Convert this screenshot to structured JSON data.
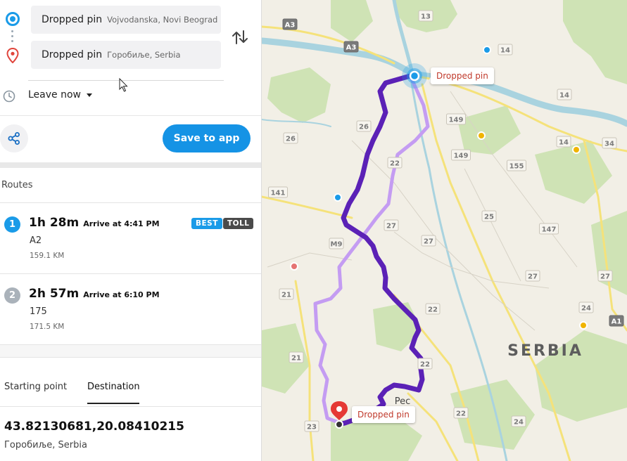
{
  "directions": {
    "origin": {
      "title": "Dropped pin",
      "subtitle": "Vojvodanska, Novi Beograd"
    },
    "destination": {
      "title": "Dropped pin",
      "subtitle": "Горобиље, Serbia"
    },
    "leave_label": "Leave now"
  },
  "actions": {
    "save_label": "Save to app"
  },
  "routes": {
    "heading": "Routes",
    "items": [
      {
        "number": "1",
        "duration": "1h 28m",
        "arrive": "Arrive at 4:41 PM",
        "road": "A2",
        "distance": "159.1 KM",
        "badges": [
          "BEST",
          "TOLL"
        ]
      },
      {
        "number": "2",
        "duration": "2h 57m",
        "arrive": "Arrive at 6:10 PM",
        "road": "175",
        "distance": "171.5 KM"
      }
    ]
  },
  "tabs": {
    "start": "Starting point",
    "destination": "Destination"
  },
  "destination_detail": {
    "coords": "43.82130681,20.08410215",
    "place": "Горобиље, Serbia"
  },
  "map": {
    "country_label": "SERBIA",
    "town_label": "Pec",
    "origin_callout": "Dropped pin",
    "dest_callout": "Dropped pin",
    "road_labels": {
      "a3a": "A3",
      "a3b": "A3",
      "r13": "13",
      "r14a": "14",
      "r14b": "14",
      "r14c": "14",
      "r149a": "149",
      "r149b": "149",
      "r34": "34",
      "r155": "155",
      "r26a": "26",
      "r26b": "26",
      "r22a": "22",
      "r141": "141",
      "r27a": "27",
      "r25": "25",
      "r147": "147",
      "m9": "M9",
      "r27b": "27",
      "r21a": "21",
      "r27c": "27",
      "r27d": "27",
      "r24a": "24",
      "a1": "A1",
      "r22b": "22",
      "r21b": "21",
      "r22c": "22",
      "r22d": "22",
      "r23": "23",
      "r24b": "24"
    }
  },
  "colors": {
    "route_best": "#5b21b6",
    "route_alt": "#c49cf2",
    "accent": "#1593e5",
    "badge_best": "#1a9be8",
    "badge_toll": "#4a4a4a",
    "river": "#a9d3df",
    "forest": "#cfe3b5",
    "road": "#f5e27a"
  }
}
